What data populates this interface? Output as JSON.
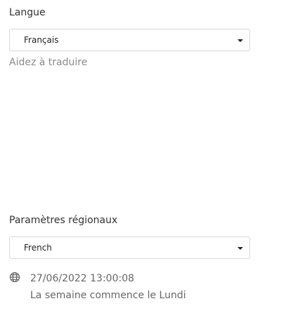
{
  "language": {
    "heading": "Langue",
    "selected": "Français",
    "help_link": "Aidez à traduire"
  },
  "regional": {
    "heading": "Paramètres régionaux",
    "selected": "French",
    "sample_datetime": "27/06/2022 13:00:08",
    "week_start": "La semaine commence le Lundi"
  },
  "icons": {
    "dropdown": "chevron-down-icon",
    "locale": "globe-icon"
  }
}
